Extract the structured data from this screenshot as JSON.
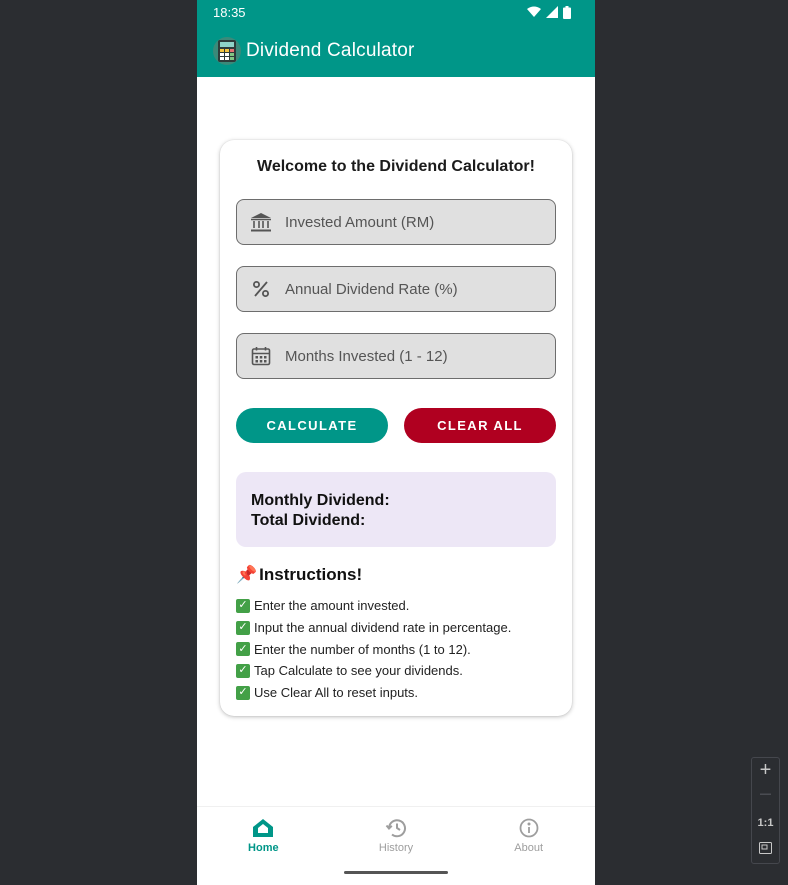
{
  "status_bar": {
    "time": "18:35"
  },
  "app_bar": {
    "title": "Dividend Calculator"
  },
  "card": {
    "welcome": "Welcome to the Dividend Calculator!",
    "fields": {
      "amount_placeholder": "Invested Amount (RM)",
      "rate_placeholder": "Annual Dividend Rate (%)",
      "months_placeholder": "Months Invested (1 - 12)"
    },
    "buttons": {
      "calculate": "CALCULATE",
      "clear": "CLEAR ALL"
    },
    "result": {
      "monthly_label": "Monthly Dividend:",
      "total_label": "Total Dividend:"
    },
    "instructions": {
      "emoji": "📌",
      "title": "Instructions!",
      "items": [
        "Enter the amount invested.",
        "Input the annual dividend rate in percentage.",
        "Enter the number of months (1 to 12).",
        "Tap Calculate to see your dividends.",
        "Use Clear All to reset inputs."
      ]
    }
  },
  "bottom_nav": {
    "items": [
      {
        "label": "Home",
        "icon": "home-icon",
        "active": true
      },
      {
        "label": "History",
        "icon": "history-icon",
        "active": false
      },
      {
        "label": "About",
        "icon": "info-icon",
        "active": false
      }
    ]
  },
  "zoom_panel": {
    "plus": "+",
    "minus": "—",
    "ratio": "1:1"
  },
  "colors": {
    "primary": "#009688",
    "danger": "#b00020",
    "result_bg": "#ede7f6"
  }
}
